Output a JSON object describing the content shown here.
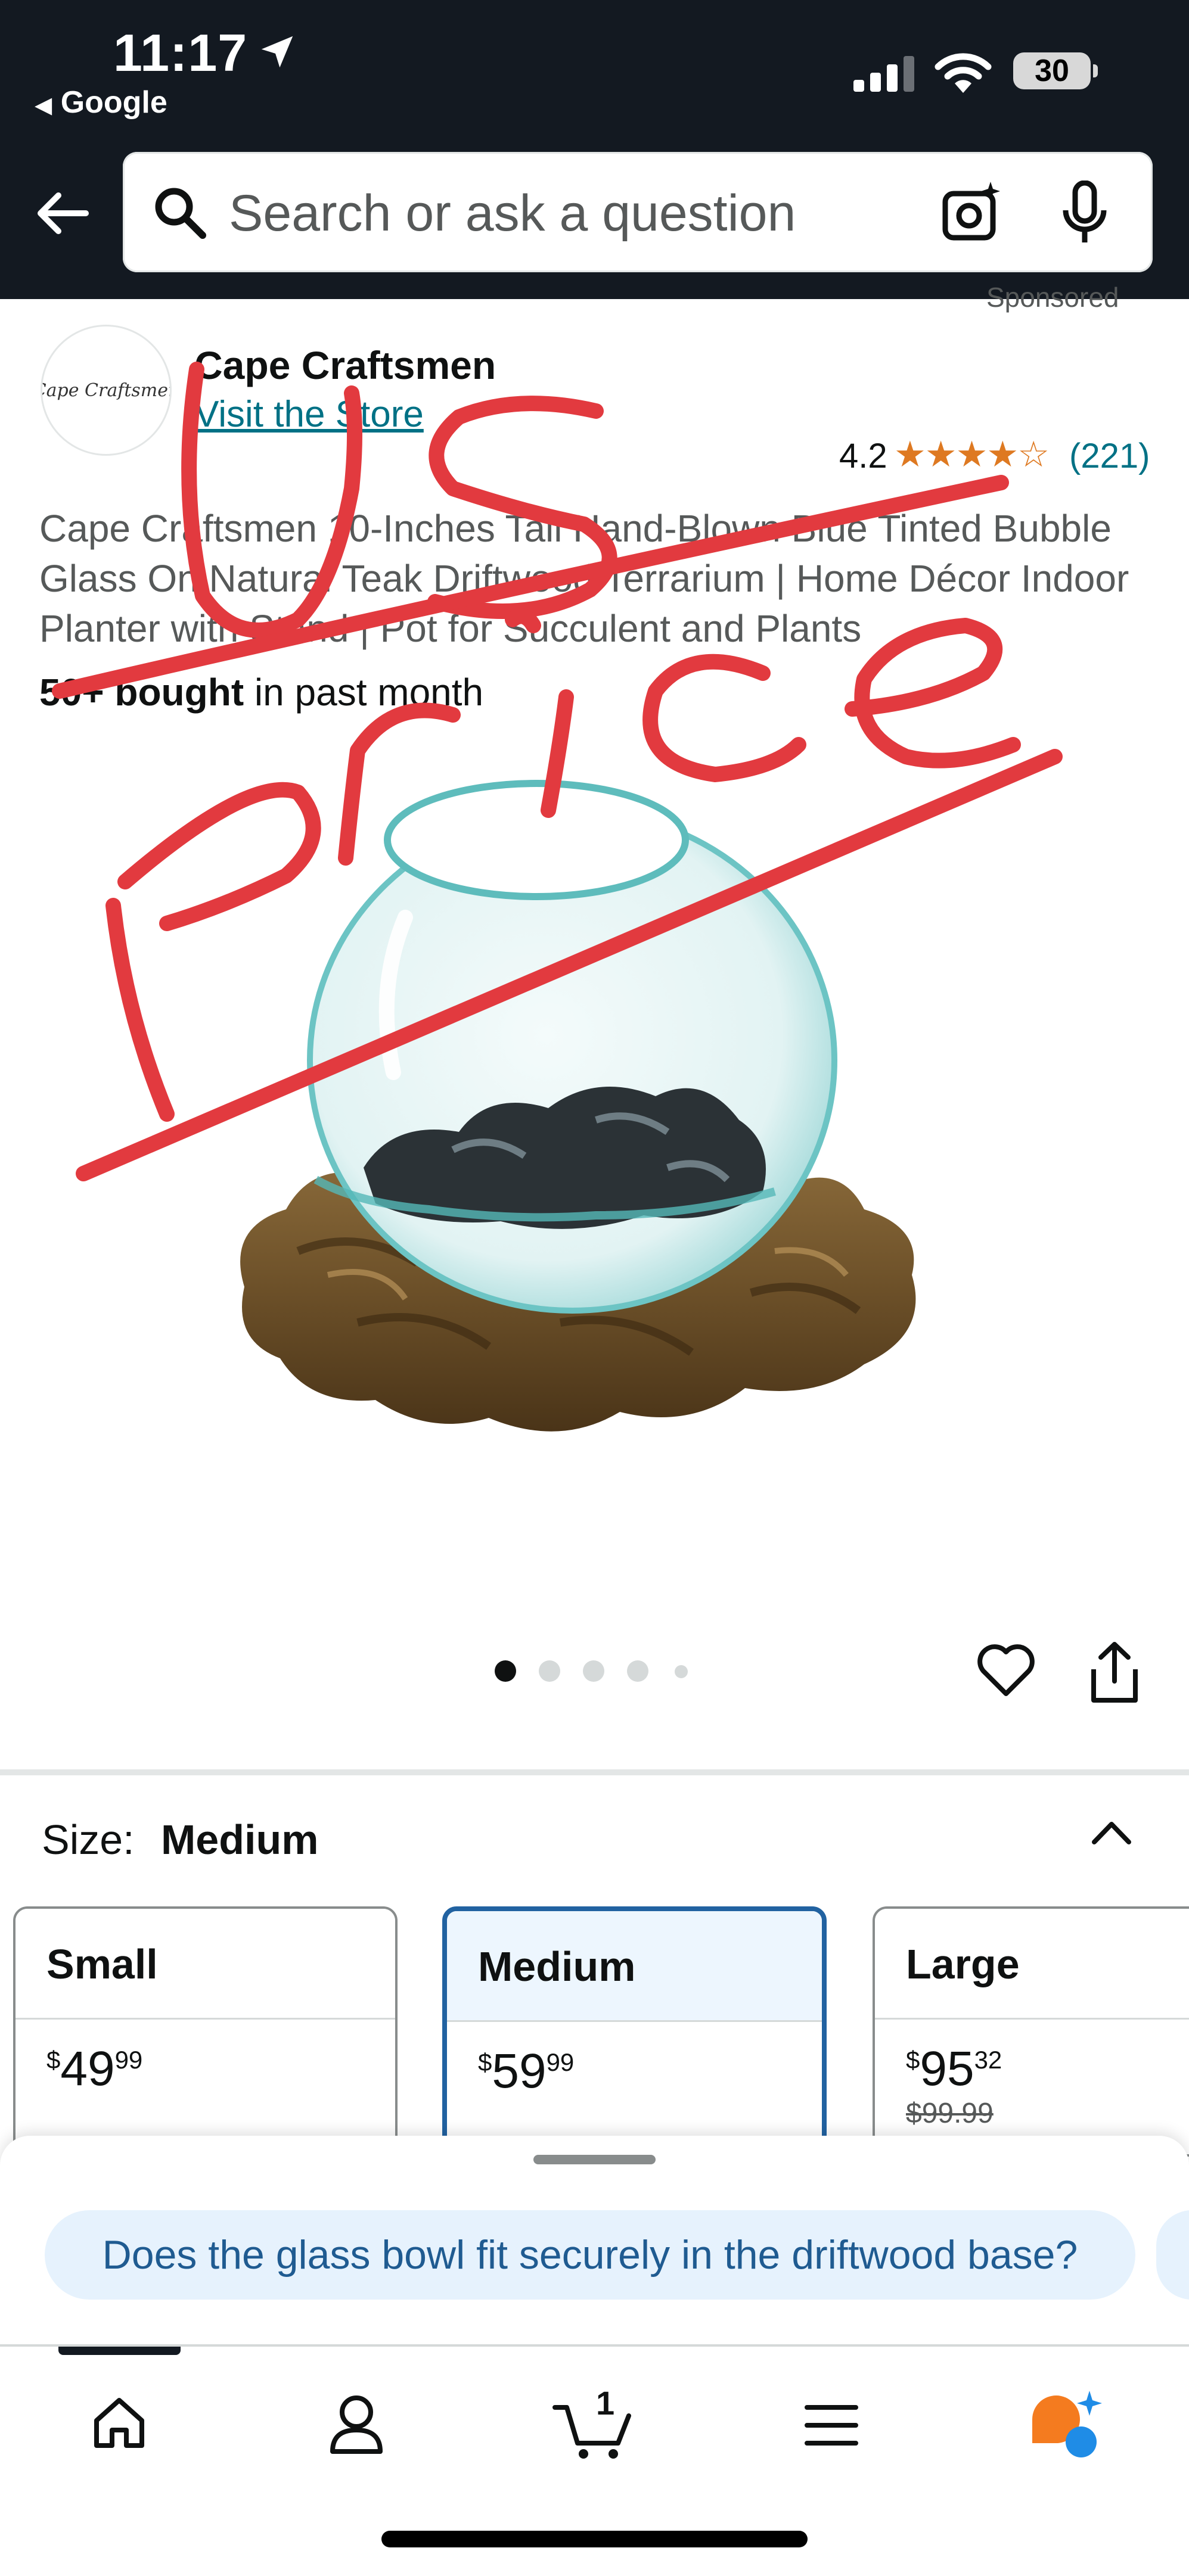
{
  "status_bar": {
    "time": "11:17",
    "back_app": "Google",
    "battery": "30"
  },
  "search": {
    "placeholder": "Search or ask a question"
  },
  "header": {
    "sponsored": "Sponsored"
  },
  "store": {
    "logo_text": "Cape Craftsmen",
    "brand": "Cape Craftsmen",
    "visit_store": "Visit the Store"
  },
  "rating": {
    "value": "4.2",
    "count": "(221)",
    "stars": 4.2
  },
  "product": {
    "title": "Cape Craftsmen 10-Inches Tall Hand-Blown Blue Tinted Bubble Glass On Natural Teak Driftwood Terrarium | Home Décor Indoor Planter with Stand | Pot for Succulent and Plants",
    "bought_bold": "50+ bought",
    "bought_rest": " in past month",
    "image_index": 1,
    "image_count": 5
  },
  "size_selector": {
    "label": "Size:",
    "selected": "Medium",
    "options": [
      {
        "name": "Small",
        "dollar": "49",
        "cents": "99",
        "was": ""
      },
      {
        "name": "Medium",
        "dollar": "59",
        "cents": "99",
        "was": ""
      },
      {
        "name": "Large",
        "dollar": "95",
        "cents": "32",
        "was": "$99.99"
      }
    ],
    "currency": "$"
  },
  "suggestion": {
    "question": "Does the glass bowl fit securely in the driftwood base?"
  },
  "tabbar": {
    "items": [
      "home-icon",
      "account-icon",
      "cart-icon",
      "menu-icon",
      "rufus-icon"
    ],
    "cart_count": "1"
  },
  "annotation": {
    "text": "US Price",
    "color": "#e23a3f"
  },
  "colors": {
    "header_bg": "#131921",
    "link": "#007185",
    "star": "#de7921",
    "selected_border": "#2162a1"
  }
}
